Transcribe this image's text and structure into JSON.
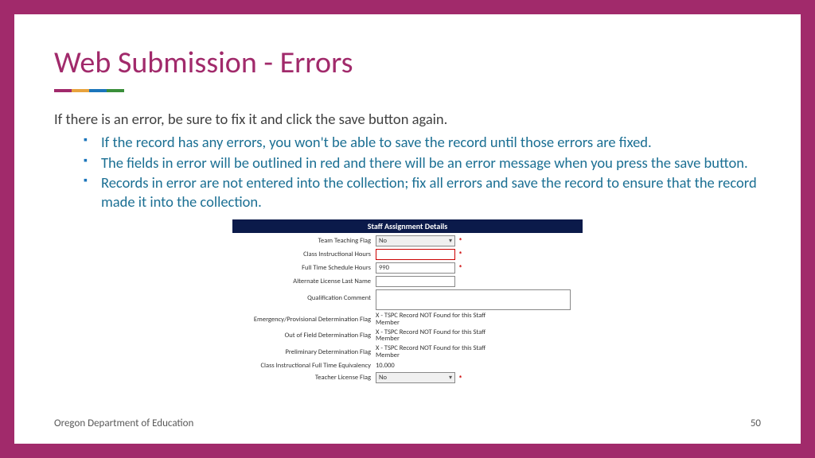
{
  "title": "Web Submission - Errors",
  "intro": "If there is an error, be sure to fix it and click the save button again.",
  "bullets": [
    "If the record has any errors, you won't be able to save the record until those errors are fixed.",
    "The fields in error will be outlined in red and there will be an error message when you press the save button.",
    "Records in error are not entered into the collection; fix all errors and save the record to ensure that the record made it into the collection."
  ],
  "form": {
    "header": "Staff Assignment Details",
    "rows": {
      "team_teaching_label": "Team Teaching Flag",
      "team_teaching_value": "No",
      "class_hours_label": "Class Instructional Hours",
      "class_hours_value": "",
      "full_time_label": "Full Time Schedule Hours",
      "full_time_value": "990",
      "alt_license_label": "Alternate License Last Name",
      "alt_license_value": "",
      "qual_comment_label": "Qualification Comment",
      "emergency_label": "Emergency/Provisional Determination Flag",
      "emergency_value": "X - TSPC Record NOT Found for this Staff Member",
      "outfield_label": "Out of Field Determination Flag",
      "outfield_value": "X - TSPC Record NOT Found for this Staff Member",
      "prelim_label": "Preliminary Determination Flag",
      "prelim_value": "X - TSPC Record NOT Found for this Staff Member",
      "fte_label": "Class Instructional Full Time Equivalency",
      "fte_value": "10.000",
      "teacher_license_label": "Teacher License Flag",
      "teacher_license_value": "No"
    },
    "required_marker": "*"
  },
  "footer": {
    "org": "Oregon Department of Education",
    "page": "50"
  }
}
